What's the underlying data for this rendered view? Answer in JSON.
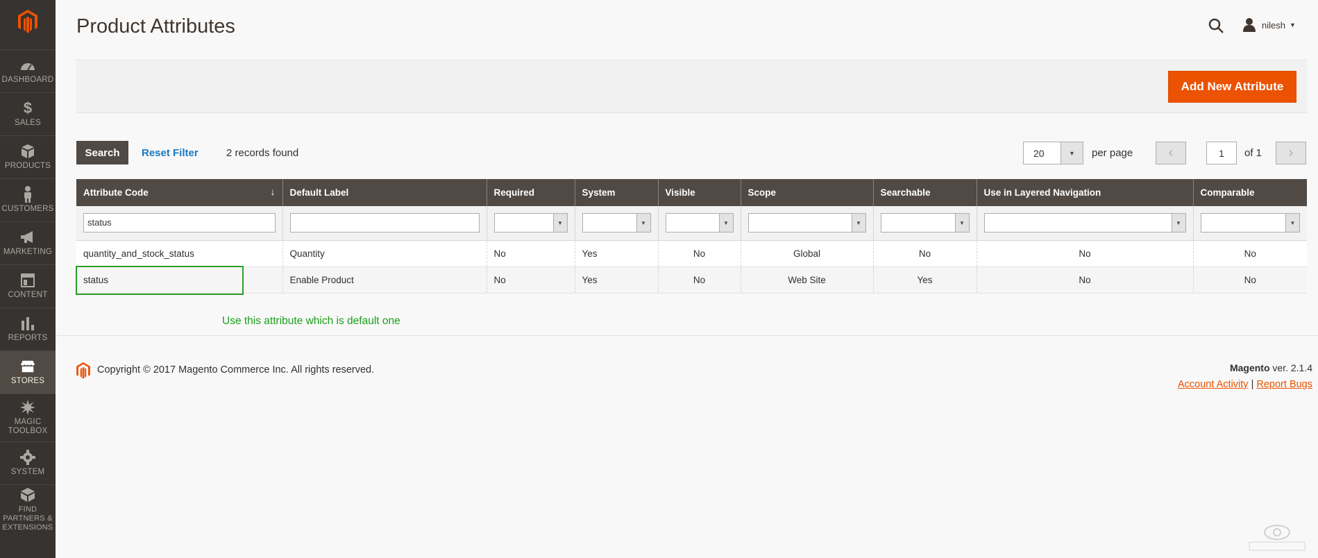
{
  "sidebar": {
    "items": [
      {
        "label": "DASHBOARD",
        "icon": "dashboard-icon"
      },
      {
        "label": "SALES",
        "icon": "dollar-icon"
      },
      {
        "label": "PRODUCTS",
        "icon": "cube-icon"
      },
      {
        "label": "CUSTOMERS",
        "icon": "person-icon"
      },
      {
        "label": "MARKETING",
        "icon": "megaphone-icon"
      },
      {
        "label": "CONTENT",
        "icon": "layout-icon"
      },
      {
        "label": "REPORTS",
        "icon": "bar-chart-icon"
      },
      {
        "label": "STORES",
        "icon": "storefront-icon",
        "active": true
      },
      {
        "label": "MAGIC TOOLBOX",
        "icon": "star-burst-icon"
      },
      {
        "label": "SYSTEM",
        "icon": "gear-icon"
      },
      {
        "label": "FIND PARTNERS & EXTENSIONS",
        "icon": "box-icon"
      }
    ]
  },
  "header": {
    "title": "Product Attributes",
    "user": "nilesh"
  },
  "actions": {
    "add_new": "Add New Attribute"
  },
  "toolbar": {
    "search_label": "Search",
    "reset_label": "Reset Filter",
    "records": "2 records found",
    "per_page_value": "20",
    "per_page_label": "per page",
    "page_value": "1",
    "page_of": "of 1"
  },
  "table": {
    "columns": [
      "Attribute Code",
      "Default Label",
      "Required",
      "System",
      "Visible",
      "Scope",
      "Searchable",
      "Use in Layered Navigation",
      "Comparable"
    ],
    "filters": {
      "attribute_code": "status",
      "default_label": ""
    },
    "rows": [
      [
        "quantity_and_stock_status",
        "Quantity",
        "No",
        "Yes",
        "No",
        "Global",
        "No",
        "No",
        "No"
      ],
      [
        "status",
        "Enable Product",
        "No",
        "Yes",
        "No",
        "Web Site",
        "Yes",
        "No",
        "No"
      ]
    ]
  },
  "annotation": "Use this attribute which is default one",
  "footer": {
    "copyright": "Copyright © 2017 Magento Commerce Inc. All rights reserved.",
    "brand": "Magento",
    "version": " ver. 2.1.4",
    "account_activity": "Account Activity",
    "separator": "|",
    "report_bugs": "Report Bugs"
  },
  "colors": {
    "sidebar_bg": "#373330",
    "accent": "#eb5202",
    "header_row": "#514943",
    "link": "#1979c3",
    "annotation": "#1aa01a"
  }
}
